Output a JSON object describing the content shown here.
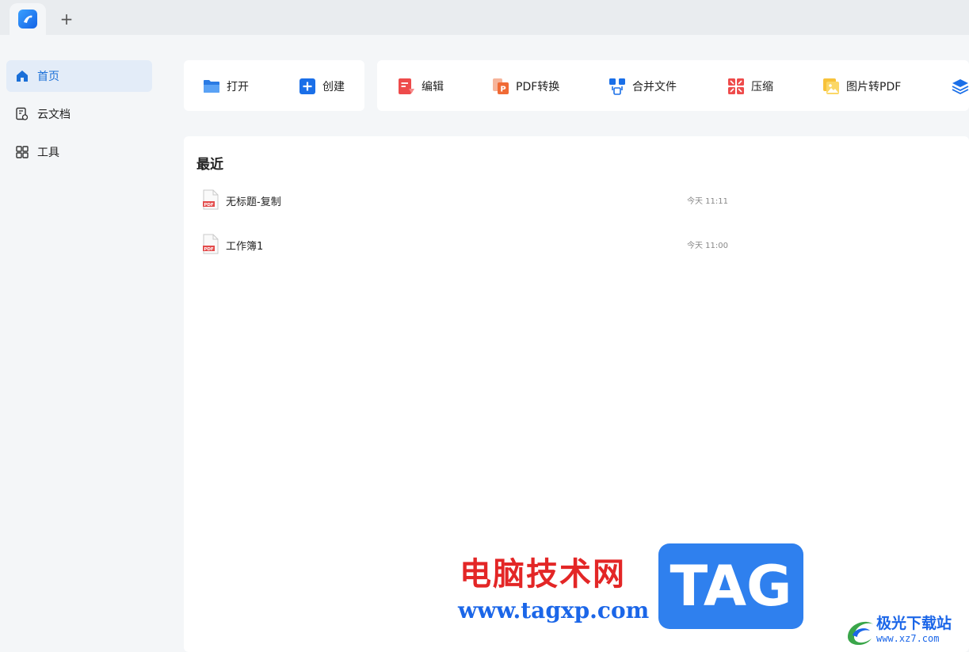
{
  "tabbar": {
    "new_tab_label": "+"
  },
  "sidebar": {
    "items": [
      {
        "label": "首页",
        "icon": "home-icon",
        "active": true
      },
      {
        "label": "云文档",
        "icon": "cloud-doc-icon",
        "active": false
      },
      {
        "label": "工具",
        "icon": "grid-icon",
        "active": false
      }
    ]
  },
  "toolbar": {
    "open": "打开",
    "create": "创建",
    "edit": "编辑",
    "pdf_convert": "PDF转换",
    "merge": "合并文件",
    "compress": "压缩",
    "image_to_pdf": "图片转PDF"
  },
  "recent": {
    "title": "最近",
    "files": [
      {
        "name": "无标题-复制",
        "time": "今天 11:11"
      },
      {
        "name": "工作簿1",
        "time": "今天 11:00"
      }
    ]
  },
  "watermark": {
    "cn": "电脑技术网",
    "url": "www.tagxp.com",
    "tag": "TAG",
    "site_name": "极光下载站",
    "site_url": "www.xz7.com"
  },
  "colors": {
    "accent": "#1a6fd8",
    "watermark_red": "#e32626",
    "watermark_blue": "#2f80ee"
  }
}
